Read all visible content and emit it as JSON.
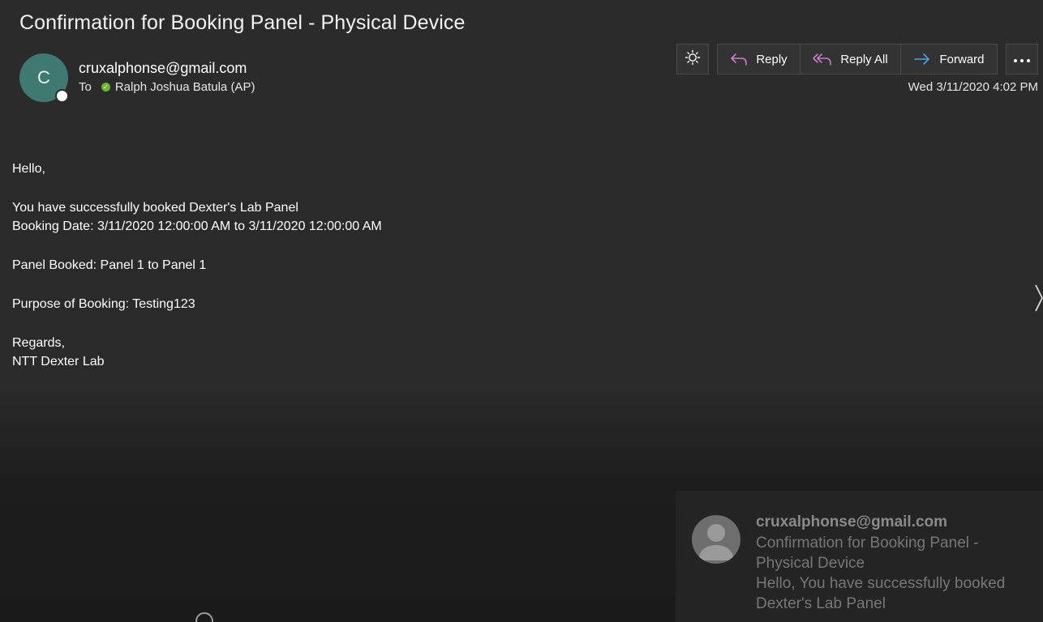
{
  "email": {
    "subject": "Confirmation for Booking Panel - Physical Device",
    "avatar_initial": "C",
    "sender": "cruxalphonse@gmail.com",
    "to_label": "To",
    "recipient": "Ralph Joshua Batula (AP)",
    "date": "Wed 3/11/2020 4:02 PM",
    "body": {
      "greeting": "Hello,",
      "line1": "You have successfully booked Dexter's Lab Panel",
      "line2": "Booking Date: 3/11/2020 12:00:00 AM to 3/11/2020 12:00:00 AM",
      "line3": "Panel Booked: Panel 1 to Panel 1",
      "line4": "Purpose of Booking: Testing123",
      "line5": "Regards,",
      "line6": "NTT Dexter Lab"
    }
  },
  "toolbar": {
    "reply_label": "Reply",
    "reply_all_label": "Reply All",
    "forward_label": "Forward",
    "theme_icon": "sun-icon",
    "more_icon": "more-icon"
  },
  "notification": {
    "sender": "cruxalphonse@gmail.com",
    "subject": "Confirmation for Booking Panel - Physical Device",
    "preview": "Hello,  You have successfully booked Dexter's Lab Panel"
  },
  "colors": {
    "avatar": "#3f7a72",
    "presence_ok": "#6cb52d",
    "reply_icon": "#c77ec4",
    "forward_icon": "#4aa3e8"
  }
}
